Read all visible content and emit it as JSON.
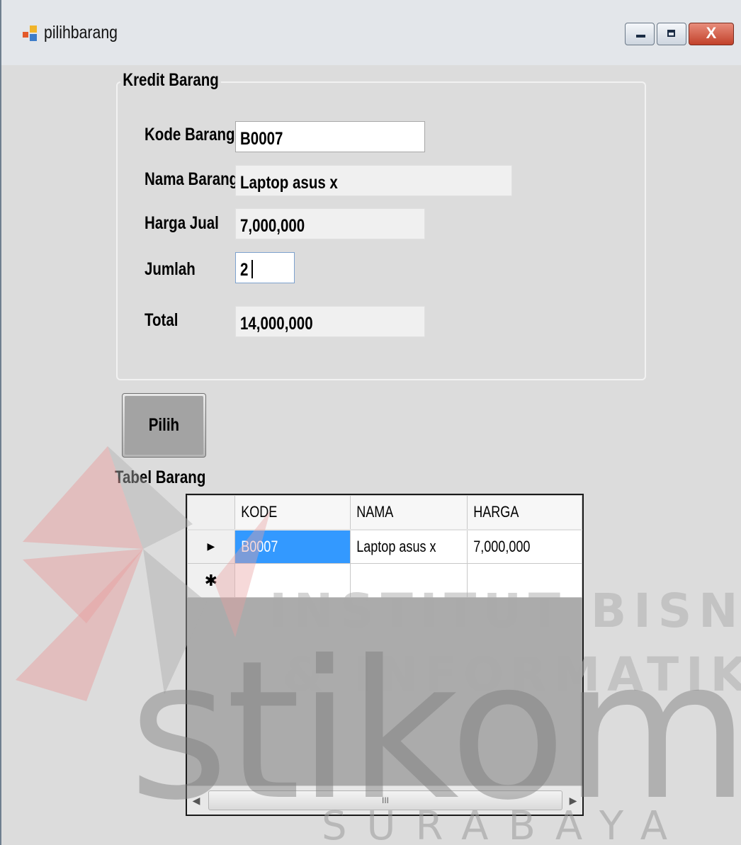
{
  "window": {
    "title": "pilihbarang",
    "controls": {
      "minimize": "minimize-icon",
      "maximize": "maximize-icon",
      "close_glyph": "X"
    }
  },
  "form": {
    "group_title": "Kredit Barang",
    "kode_label": "Kode Barang",
    "kode_value": "B0007",
    "nama_label": "Nama Barang",
    "nama_value": "Laptop asus x",
    "harga_label": "Harga Jual",
    "harga_value": "7,000,000",
    "jumlah_label": "Jumlah",
    "jumlah_value": "2",
    "total_label": "Total",
    "total_value": "14,000,000"
  },
  "pilih_button": "Pilih",
  "table": {
    "label": "Tabel Barang",
    "columns": [
      "KODE",
      "NAMA",
      "HARGA"
    ],
    "rows": [
      {
        "indicator": "▶",
        "kode": "B0007",
        "nama": "Laptop asus x",
        "harga": "7,000,000"
      }
    ],
    "new_row_indicator": "✱",
    "scroll_thumb_grip": "III"
  },
  "watermark": {
    "line1": "INSTITUT BISNIS",
    "line2": "& INFORMATIKA",
    "logo": "stikom",
    "line3": "SURABAYA"
  },
  "colors": {
    "selection": "#3399ff",
    "window_bg": "#dcdcdc",
    "close_button": "#c2412a"
  }
}
